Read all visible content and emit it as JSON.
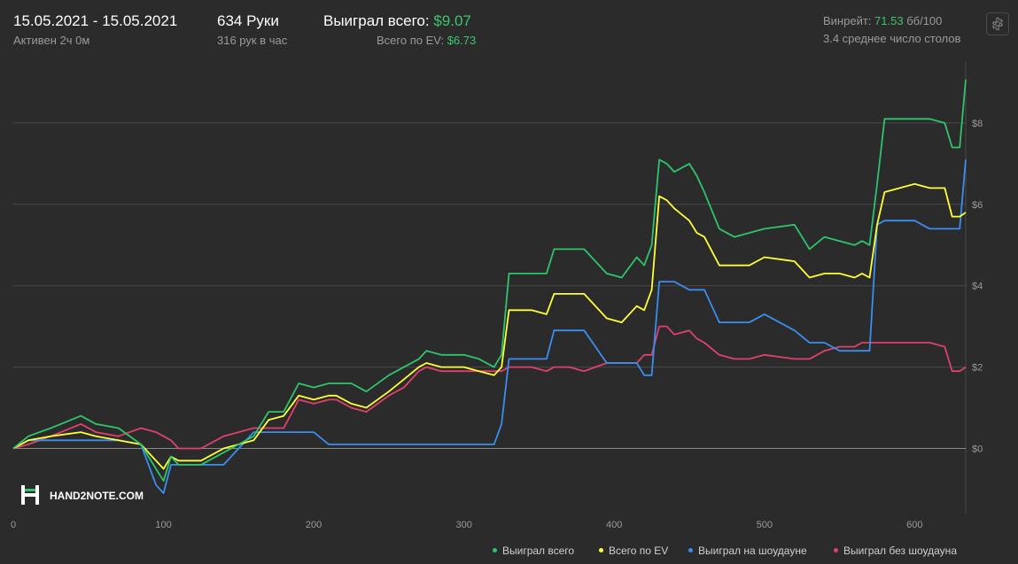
{
  "header": {
    "date_range": "15.05.2021 - 15.05.2021",
    "active": "Активен 2ч 0м",
    "hands": "634 Руки",
    "hands_per_hour": "316 рук в час",
    "won_total_label": "Выиграл всего:",
    "won_total_value": "$9.07",
    "ev_total_label": "Всего по EV:",
    "ev_total_value": "$6.73",
    "winrate_label": "Винрейт:",
    "winrate_value": "71.53",
    "winrate_unit": "бб/100",
    "avg_tables": "3.4 среднее число столов",
    "settings_icon": "gear-icon"
  },
  "logo": {
    "text": "HAND2NOTE.COM"
  },
  "colors": {
    "background": "#2b2b2b",
    "grid": "#4a4a4a",
    "zero_line": "#8a8a8a",
    "won": "#2ec56a",
    "ev": "#ffff3a",
    "showdown": "#3a8ef0",
    "non_showdown": "#e0406e"
  },
  "chart_data": {
    "type": "line",
    "x_ticks": [
      0,
      100,
      200,
      300,
      400,
      500,
      600
    ],
    "y_ticks": [
      "$0",
      "$2",
      "$4",
      "$6",
      "$8"
    ],
    "xlim": [
      0,
      634
    ],
    "ylim": [
      -1.6,
      9.5
    ],
    "y_tick_values": [
      0,
      2,
      4,
      6,
      8
    ],
    "grid": true,
    "legend_position": "bottom-right",
    "series": [
      {
        "name": "Выиграл всего",
        "color": "#2ec56a",
        "x": [
          0,
          10,
          25,
          45,
          55,
          70,
          85,
          95,
          100,
          105,
          110,
          125,
          140,
          160,
          170,
          180,
          190,
          200,
          210,
          215,
          225,
          235,
          250,
          260,
          270,
          275,
          285,
          300,
          310,
          320,
          325,
          330,
          335,
          345,
          355,
          360,
          370,
          380,
          395,
          405,
          415,
          420,
          425,
          430,
          435,
          440,
          450,
          455,
          460,
          470,
          480,
          490,
          500,
          520,
          530,
          540,
          550,
          560,
          565,
          570,
          575,
          580,
          590,
          600,
          610,
          620,
          625,
          630,
          634
        ],
        "y": [
          0,
          0.3,
          0.5,
          0.8,
          0.6,
          0.5,
          0.1,
          -0.5,
          -0.8,
          -0.2,
          -0.4,
          -0.4,
          -0.1,
          0.3,
          0.9,
          0.9,
          1.6,
          1.5,
          1.6,
          1.6,
          1.6,
          1.4,
          1.8,
          2.0,
          2.2,
          2.4,
          2.3,
          2.3,
          2.2,
          2.0,
          2.3,
          4.3,
          4.3,
          4.3,
          4.3,
          4.9,
          4.9,
          4.9,
          4.3,
          4.2,
          4.7,
          4.5,
          5.0,
          7.1,
          7.0,
          6.8,
          7.0,
          6.7,
          6.3,
          5.4,
          5.2,
          5.3,
          5.4,
          5.5,
          4.9,
          5.2,
          5.1,
          5.0,
          5.1,
          5.0,
          6.5,
          8.1,
          8.1,
          8.1,
          8.1,
          8.0,
          7.4,
          7.4,
          9.07
        ]
      },
      {
        "name": "Всего по EV",
        "color": "#ffff3a",
        "x": [
          0,
          10,
          25,
          45,
          55,
          70,
          85,
          95,
          100,
          105,
          110,
          125,
          140,
          160,
          170,
          180,
          190,
          200,
          210,
          215,
          225,
          235,
          250,
          260,
          270,
          275,
          285,
          300,
          310,
          320,
          325,
          330,
          335,
          345,
          355,
          360,
          370,
          380,
          395,
          405,
          415,
          420,
          425,
          430,
          435,
          440,
          450,
          455,
          460,
          470,
          480,
          490,
          500,
          520,
          530,
          540,
          550,
          560,
          565,
          570,
          575,
          580,
          590,
          600,
          610,
          620,
          625,
          630,
          634
        ],
        "y": [
          0,
          0.2,
          0.3,
          0.4,
          0.3,
          0.2,
          0.1,
          -0.3,
          -0.5,
          -0.2,
          -0.3,
          -0.3,
          0.0,
          0.2,
          0.7,
          0.8,
          1.3,
          1.2,
          1.3,
          1.3,
          1.1,
          1.0,
          1.4,
          1.7,
          2.0,
          2.1,
          2.0,
          2.0,
          1.9,
          1.8,
          2.0,
          3.4,
          3.4,
          3.4,
          3.3,
          3.8,
          3.8,
          3.8,
          3.2,
          3.1,
          3.5,
          3.4,
          3.9,
          6.2,
          6.1,
          5.9,
          5.6,
          5.3,
          5.2,
          4.5,
          4.5,
          4.5,
          4.7,
          4.6,
          4.2,
          4.3,
          4.3,
          4.2,
          4.3,
          4.2,
          5.5,
          6.3,
          6.4,
          6.5,
          6.4,
          6.4,
          5.7,
          5.7,
          5.8
        ]
      },
      {
        "name": "Выиграл на шоудауне",
        "color": "#3a8ef0",
        "x": [
          0,
          10,
          25,
          45,
          55,
          70,
          85,
          95,
          100,
          105,
          110,
          125,
          140,
          160,
          170,
          180,
          190,
          200,
          210,
          215,
          225,
          235,
          250,
          260,
          270,
          275,
          285,
          300,
          310,
          320,
          325,
          330,
          335,
          345,
          355,
          360,
          370,
          380,
          395,
          405,
          415,
          420,
          425,
          430,
          435,
          440,
          450,
          455,
          460,
          470,
          480,
          490,
          500,
          520,
          530,
          540,
          550,
          560,
          565,
          570,
          575,
          580,
          590,
          600,
          610,
          620,
          625,
          630,
          634
        ],
        "y": [
          0,
          0.2,
          0.2,
          0.2,
          0.2,
          0.2,
          0.1,
          -0.9,
          -1.1,
          -0.4,
          -0.4,
          -0.4,
          -0.4,
          0.4,
          0.4,
          0.4,
          0.4,
          0.4,
          0.1,
          0.1,
          0.1,
          0.1,
          0.1,
          0.1,
          0.1,
          0.1,
          0.1,
          0.1,
          0.1,
          0.1,
          0.6,
          2.2,
          2.2,
          2.2,
          2.2,
          2.9,
          2.9,
          2.9,
          2.1,
          2.1,
          2.1,
          1.8,
          1.8,
          4.1,
          4.1,
          4.1,
          3.9,
          3.9,
          3.9,
          3.1,
          3.1,
          3.1,
          3.3,
          2.9,
          2.6,
          2.6,
          2.4,
          2.4,
          2.4,
          2.4,
          5.5,
          5.6,
          5.6,
          5.6,
          5.4,
          5.4,
          5.4,
          5.4,
          7.1
        ]
      },
      {
        "name": "Выиграл без шоудауна",
        "color": "#e0406e",
        "x": [
          0,
          10,
          25,
          45,
          55,
          70,
          85,
          95,
          100,
          105,
          110,
          125,
          140,
          160,
          170,
          180,
          190,
          200,
          210,
          215,
          225,
          235,
          250,
          260,
          270,
          275,
          285,
          300,
          310,
          320,
          325,
          330,
          335,
          345,
          355,
          360,
          370,
          380,
          395,
          405,
          415,
          420,
          425,
          430,
          435,
          440,
          450,
          455,
          460,
          470,
          480,
          490,
          500,
          520,
          530,
          540,
          550,
          560,
          565,
          570,
          575,
          580,
          590,
          600,
          610,
          620,
          625,
          630,
          634
        ],
        "y": [
          0,
          0.1,
          0.3,
          0.6,
          0.4,
          0.3,
          0.5,
          0.4,
          0.3,
          0.2,
          0.0,
          0.0,
          0.3,
          0.5,
          0.5,
          0.5,
          1.2,
          1.1,
          1.2,
          1.2,
          1.0,
          0.9,
          1.3,
          1.5,
          1.9,
          2.0,
          1.9,
          1.9,
          1.9,
          1.9,
          1.9,
          2.0,
          2.0,
          2.0,
          1.9,
          2.0,
          2.0,
          1.9,
          2.1,
          2.1,
          2.1,
          2.3,
          2.3,
          3.0,
          3.0,
          2.8,
          2.9,
          2.7,
          2.6,
          2.3,
          2.2,
          2.2,
          2.3,
          2.2,
          2.2,
          2.4,
          2.5,
          2.5,
          2.6,
          2.6,
          2.6,
          2.6,
          2.6,
          2.6,
          2.6,
          2.5,
          1.9,
          1.9,
          2.0
        ]
      }
    ]
  }
}
